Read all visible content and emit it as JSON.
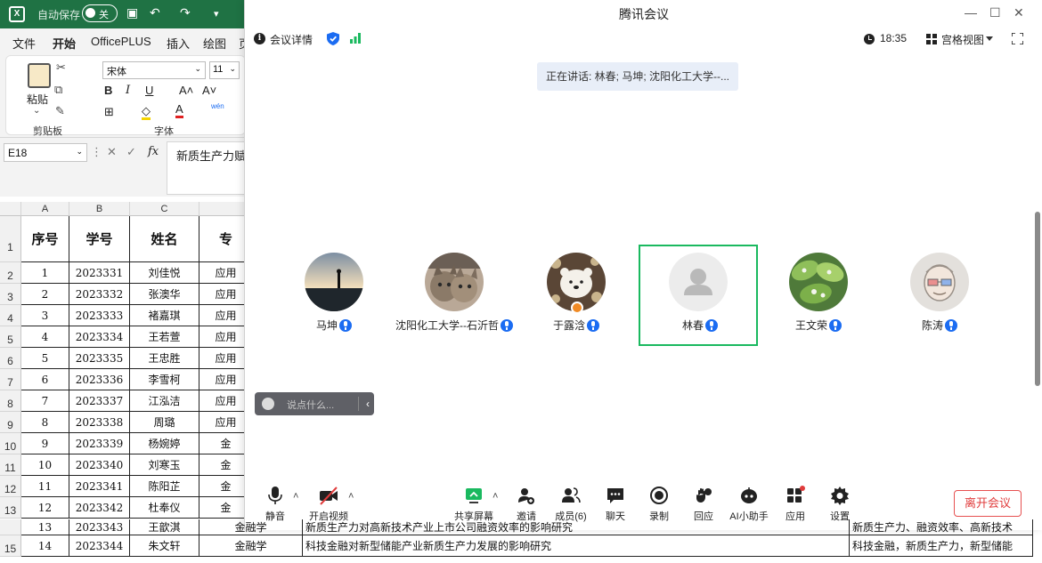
{
  "excel": {
    "logo": "X",
    "autosave_label": "自动保存",
    "autosave_state": "关",
    "menu": [
      "文件",
      "开始",
      "OfficePLUS",
      "插入",
      "绘图",
      "页"
    ],
    "ribbon": {
      "paste_label": "粘贴",
      "clipboard_group": "剪贴板",
      "font_name": "宋体",
      "font_size": "11",
      "font_group": "字体",
      "bold": "B",
      "italic": "I",
      "underline": "U",
      "grow": "A˄",
      "shrink": "A˅",
      "phonetic": "wén",
      "font_color": "A"
    },
    "name_box": "E18",
    "fx_label": "fx",
    "formula_text": "新质生产力赋",
    "columns": [
      "A",
      "B",
      "C"
    ],
    "headers": [
      "序号",
      "学号",
      "姓名",
      "专"
    ],
    "rows": [
      {
        "n": "1",
        "seq": "1",
        "id": "2023331",
        "name": "刘佳悦",
        "major": "应用"
      },
      {
        "n": "2",
        "seq": "2",
        "id": "2023332",
        "name": "张澳华",
        "major": "应用"
      },
      {
        "n": "3",
        "seq": "3",
        "id": "2023333",
        "name": "褚嘉琪",
        "major": "应用"
      },
      {
        "n": "4",
        "seq": "4",
        "id": "2023334",
        "name": "王若萱",
        "major": "应用"
      },
      {
        "n": "5",
        "seq": "5",
        "id": "2023335",
        "name": "王忠胜",
        "major": "应用"
      },
      {
        "n": "6",
        "seq": "6",
        "id": "2023336",
        "name": "李雪柯",
        "major": "应用"
      },
      {
        "n": "7",
        "seq": "7",
        "id": "2023337",
        "name": "江泓洁",
        "major": "应用"
      },
      {
        "n": "8",
        "seq": "8",
        "id": "2023338",
        "name": "周璐",
        "major": "应用"
      },
      {
        "n": "9",
        "seq": "9",
        "id": "2023339",
        "name": "杨婉婷",
        "major": "金"
      },
      {
        "n": "10",
        "seq": "10",
        "id": "2023340",
        "name": "刘寒玉",
        "major": "金"
      },
      {
        "n": "11",
        "seq": "11",
        "id": "2023341",
        "name": "陈阳芷",
        "major": "金"
      },
      {
        "n": "12",
        "seq": "12",
        "id": "2023342",
        "name": "杜奉仪",
        "major": "金"
      },
      {
        "n": "13",
        "seq": "13",
        "id": "2023343",
        "name": "王歆淇",
        "major": "金融学"
      },
      {
        "n": "14",
        "seq": "14",
        "id": "2023344",
        "name": "朱文轩",
        "major": "金融学"
      }
    ],
    "row13_topic": "新质生产力对高新技术产业上市公司融资效率的影响研究",
    "row13_keywords": "新质生产力、融资效率、高新技术",
    "row14_topic": "科技金融对新型储能产业新质生产力发展的影响研究",
    "row14_keywords": "科技金融，新质生产力，新型储能"
  },
  "meeting": {
    "window_title": "腾讯会议",
    "info_label": "会议详情",
    "time": "18:35",
    "view_label": "宫格视图",
    "speaking": "正在讲话: 林春; 马坤; 沈阳化工大学--...",
    "participants": [
      {
        "name": "马坤"
      },
      {
        "name": "沈阳化工大学--石沂哲"
      },
      {
        "name": "于露浛"
      },
      {
        "name": "林春"
      },
      {
        "name": "王文荣"
      },
      {
        "name": "陈涛"
      }
    ],
    "chat_placeholder": "说点什么...",
    "chat_collapse": "‹",
    "toolbar": {
      "mute": "静音",
      "video": "开启视频",
      "share": "共享屏幕",
      "invite": "邀请",
      "members": "成员(6)",
      "chat": "聊天",
      "record": "录制",
      "react": "回应",
      "ai": "AI小助手",
      "apps": "应用",
      "settings": "设置",
      "leave": "离开会议"
    },
    "colors": {
      "accent": "#1b6cf2",
      "active_border": "#1ab95f",
      "leave": "#e03c3c"
    }
  }
}
